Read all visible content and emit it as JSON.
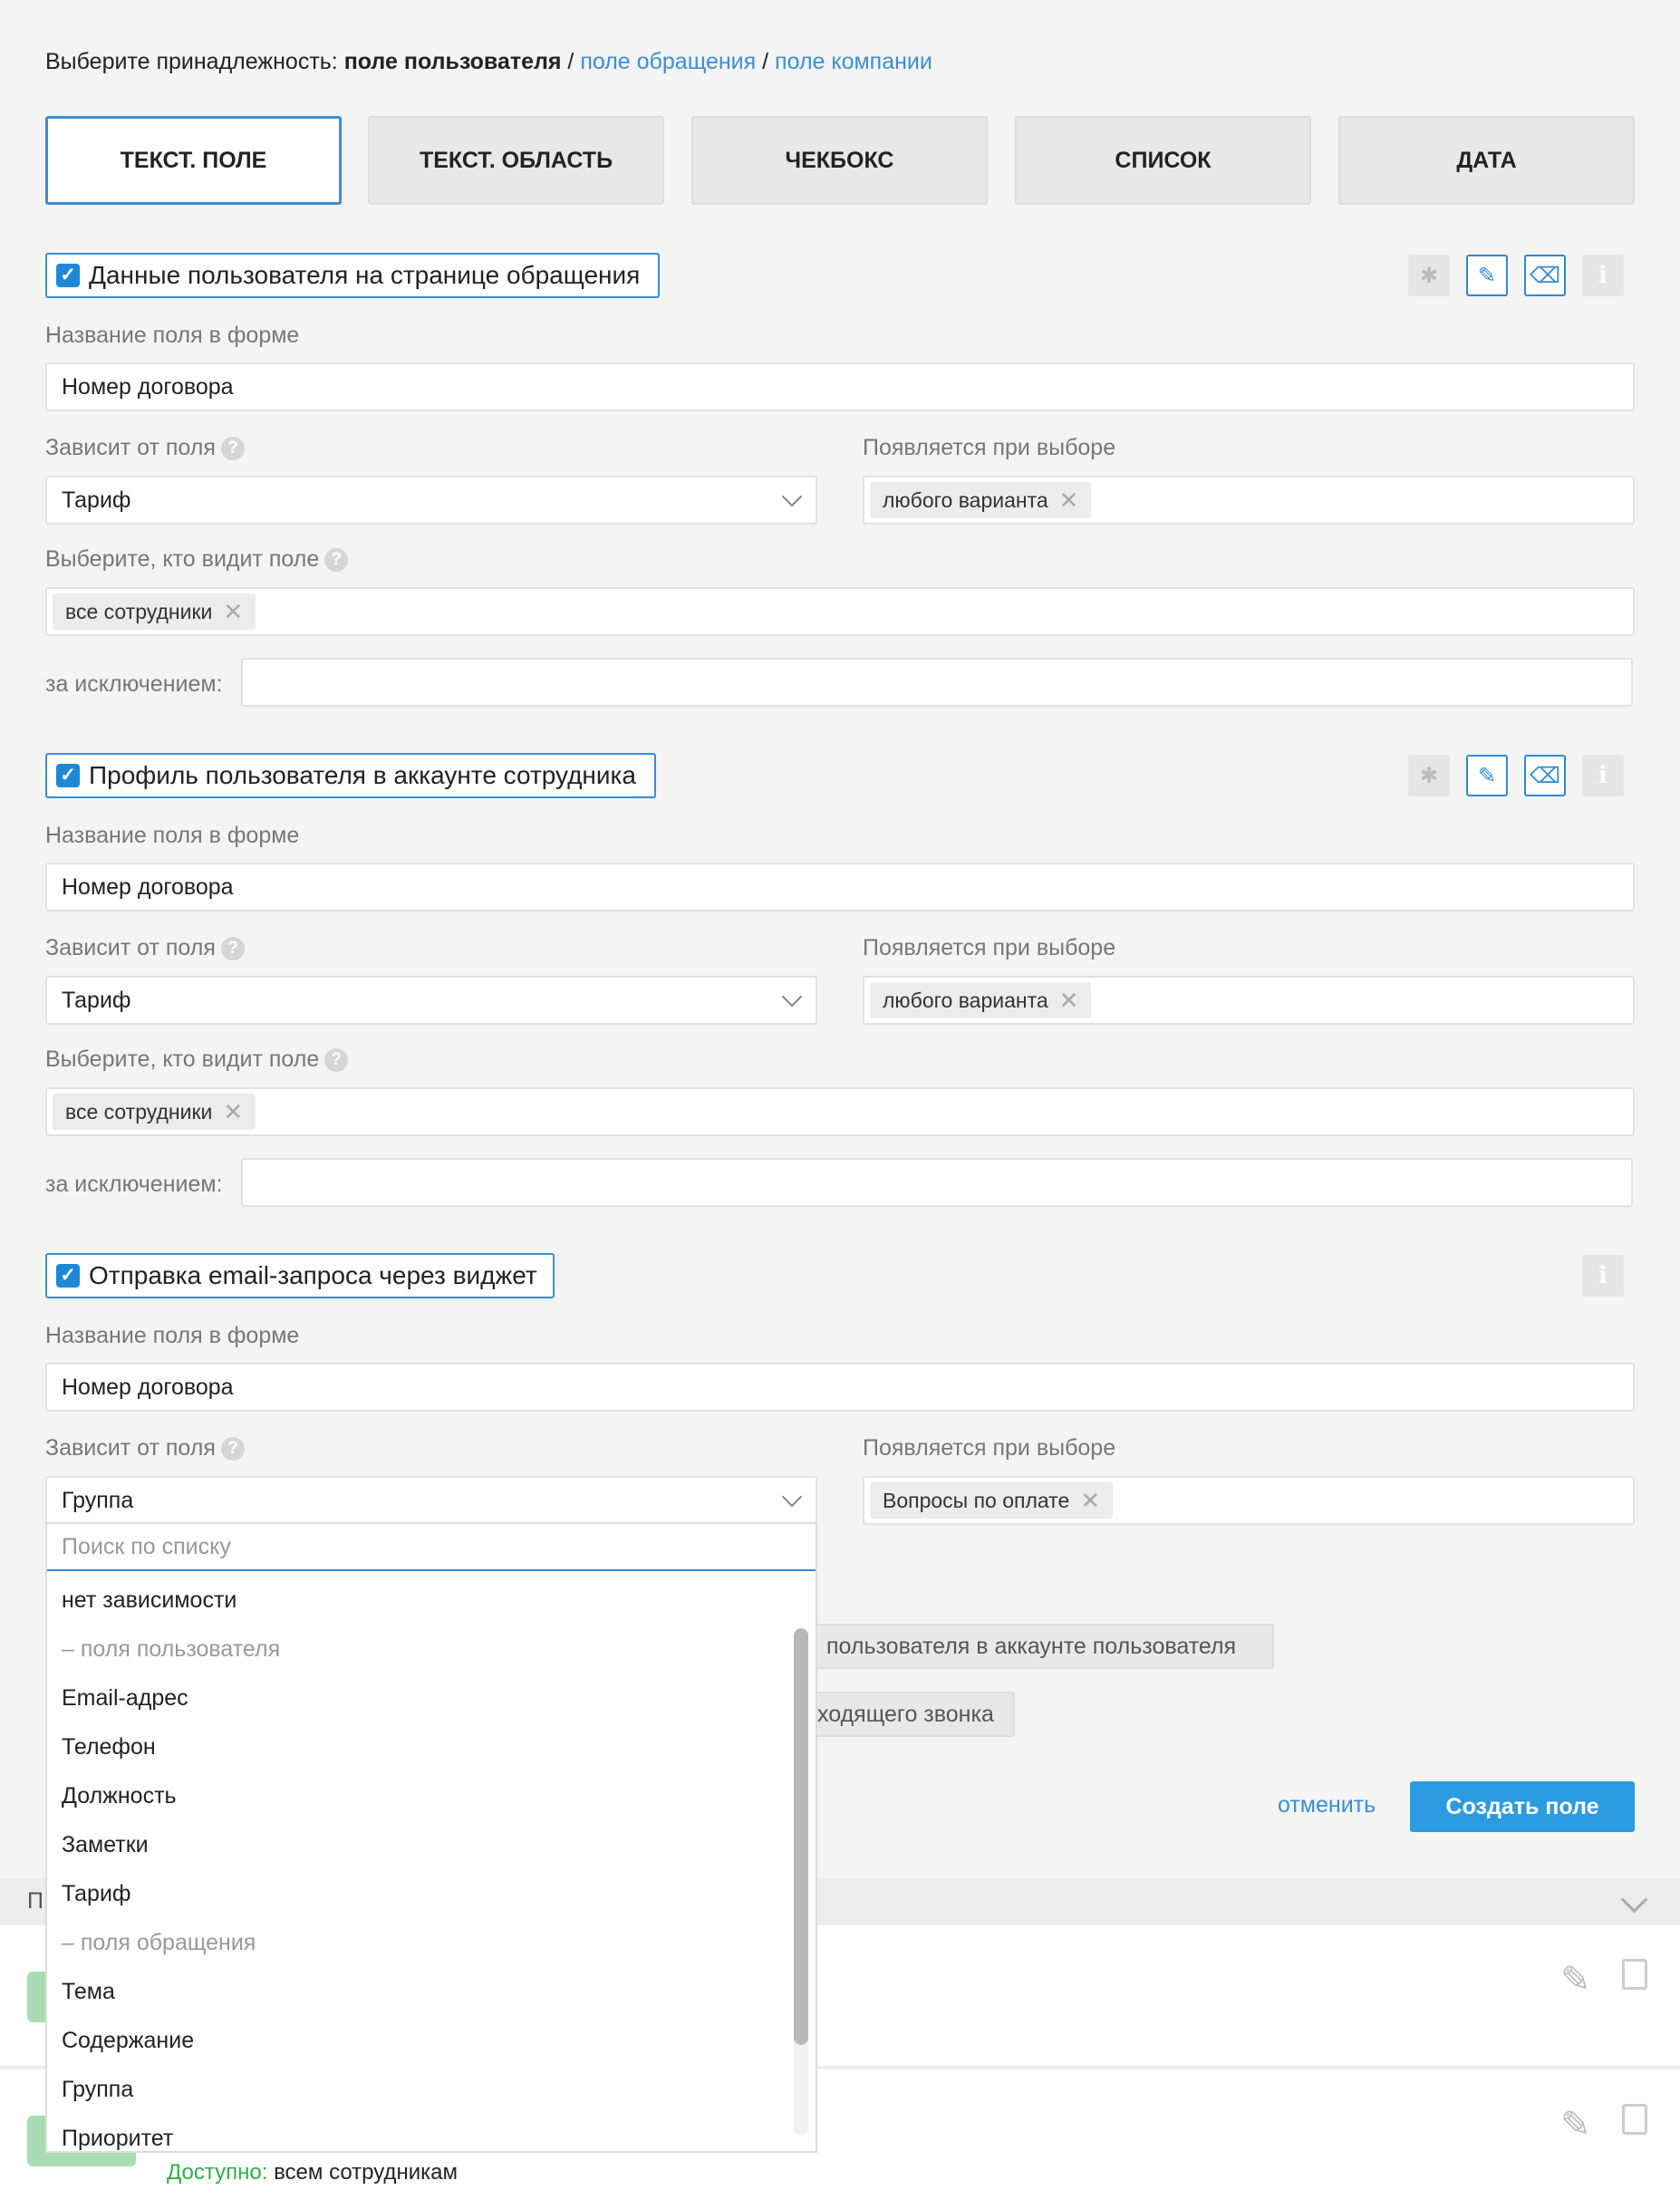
{
  "belonging": {
    "prefix": "Выберите принадлежность: ",
    "current": "поле пользователя",
    "sep1": " / ",
    "link1": "поле обращения",
    "sep2": " / ",
    "link2": "поле компании"
  },
  "tabs": [
    "ТЕКСТ. ПОЛЕ",
    "ТЕКСТ. ОБЛАСТЬ",
    "ЧЕКБОКС",
    "СПИСОК",
    "ДАТА"
  ],
  "sections": [
    {
      "title": "Данные пользователя на странице обращения",
      "field_name_label": "Название поля в форме",
      "field_name_value": "Номер договора",
      "depends_label": "Зависит от поля",
      "depends_value": "Тариф",
      "appears_label": "Появляется при выборе",
      "appears_tag": "любого варианта",
      "who_label": "Выберите, кто видит поле",
      "who_tag": "все сотрудники",
      "except_label": "за исключением:"
    },
    {
      "title": "Профиль пользователя в аккаунте сотрудника",
      "field_name_label": "Название поля в форме",
      "field_name_value": "Номер договора",
      "depends_label": "Зависит от поля",
      "depends_value": "Тариф",
      "appears_label": "Появляется при выборе",
      "appears_tag": "любого варианта",
      "who_label": "Выберите, кто видит поле",
      "who_tag": "все сотрудники",
      "except_label": "за исключением:"
    },
    {
      "title": "Отправка email-запроса через виджет",
      "field_name_label": "Название поля в форме",
      "field_name_value": "Номер договора",
      "depends_label": "Зависит от поля",
      "depends_value": "Группа",
      "appears_label": "Появляется при выборе",
      "appears_tag": "Вопросы по оплате"
    }
  ],
  "dropdown": {
    "search_placeholder": "Поиск по списку",
    "items": [
      {
        "label": "нет зависимости",
        "group": false
      },
      {
        "label": "– поля пользователя",
        "group": true
      },
      {
        "label": "Email-адрес",
        "group": false
      },
      {
        "label": "Телефон",
        "group": false
      },
      {
        "label": "Должность",
        "group": false
      },
      {
        "label": "Заметки",
        "group": false
      },
      {
        "label": "Тариф",
        "group": false
      },
      {
        "label": "– поля обращения",
        "group": true
      },
      {
        "label": "Тема",
        "group": false
      },
      {
        "label": "Содержание",
        "group": false
      },
      {
        "label": "Группа",
        "group": false
      },
      {
        "label": "Приоритет",
        "group": false
      }
    ]
  },
  "behind": {
    "chip1": "пользователя в аккаунте пользователя",
    "chip2": "ходящего звонка",
    "list_header_initial": "П"
  },
  "actions": {
    "cancel": "отменить",
    "create": "Создать поле"
  },
  "footer": {
    "available_label": "Доступно:",
    "available_value": " всем сотрудникам"
  },
  "colors": {
    "accent": "#3a8fd6",
    "primary_button": "#2d9be0",
    "available_green": "#2fae4a"
  }
}
